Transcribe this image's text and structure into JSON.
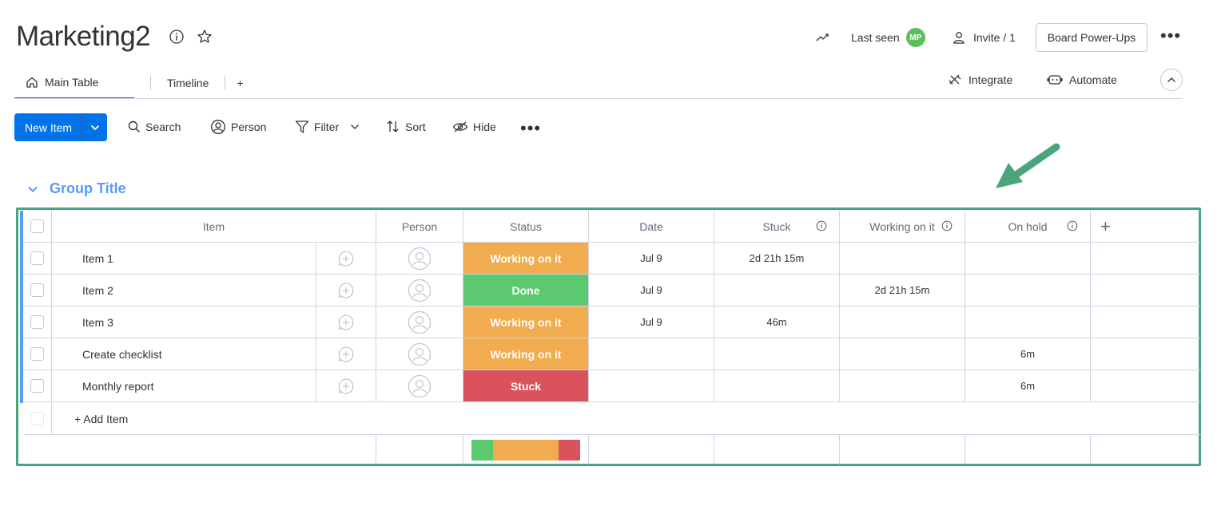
{
  "header": {
    "board_title": "Marketing2",
    "last_seen_label": "Last seen",
    "avatar_initials": "MP",
    "invite_label": "Invite / 1",
    "powerups_label": "Board Power-Ups"
  },
  "tabs": {
    "main": "Main Table",
    "timeline": "Timeline",
    "add": "+",
    "integrate": "Integrate",
    "automate": "Automate"
  },
  "toolbar": {
    "new_item": "New Item",
    "search": "Search",
    "person": "Person",
    "filter": "Filter",
    "sort": "Sort",
    "hide": "Hide"
  },
  "group": {
    "title": "Group Title",
    "columns": {
      "item": "Item",
      "person": "Person",
      "status": "Status",
      "date": "Date",
      "stuck": "Stuck",
      "working": "Working on it",
      "onhold": "On hold",
      "add": "+"
    },
    "rows": [
      {
        "name": "Item 1",
        "status": "Working on it",
        "status_color": "#f0ac4e",
        "date": "Jul 9",
        "stuck": "2d 21h 15m",
        "working": "",
        "onhold": ""
      },
      {
        "name": "Item 2",
        "status": "Done",
        "status_color": "#5ac96f",
        "date": "Jul 9",
        "stuck": "",
        "working": "2d 21h 15m",
        "onhold": ""
      },
      {
        "name": "Item 3",
        "status": "Working on it",
        "status_color": "#f0ac4e",
        "date": "Jul 9",
        "stuck": "46m",
        "working": "",
        "onhold": ""
      },
      {
        "name": "Create checklist",
        "status": "Working on it",
        "status_color": "#f0ac4e",
        "date": "",
        "stuck": "",
        "working": "",
        "onhold": "6m"
      },
      {
        "name": "Monthly report",
        "status": "Stuck",
        "status_color": "#d9525c",
        "date": "",
        "stuck": "",
        "working": "",
        "onhold": "6m"
      }
    ],
    "add_item_label": "+ Add Item",
    "status_summary": [
      {
        "label": "Done",
        "fraction": 0.2,
        "color": "#5ac96f"
      },
      {
        "label": "Working on it",
        "fraction": 0.6,
        "color": "#f0ac4e"
      },
      {
        "label": "Stuck",
        "fraction": 0.2,
        "color": "#d9525c"
      }
    ]
  },
  "colors": {
    "primary": "#0073ea",
    "group": "#579bfc",
    "highlight_border": "#4aa57c"
  }
}
